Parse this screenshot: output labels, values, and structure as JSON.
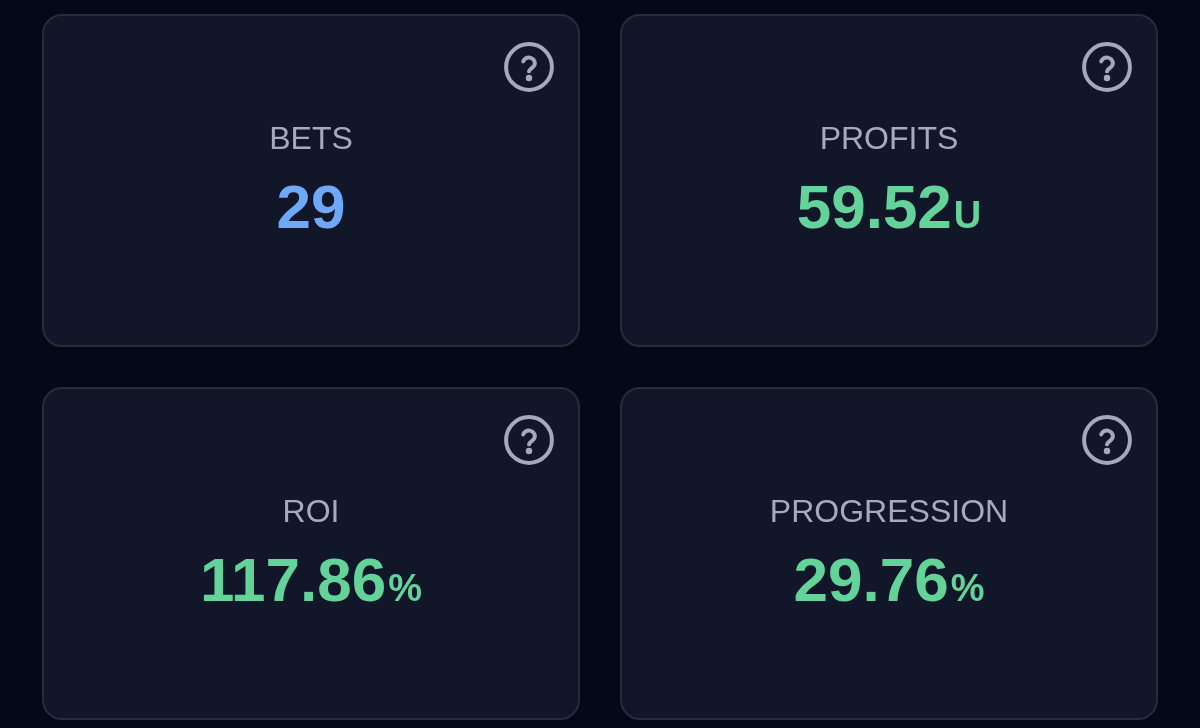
{
  "cards": [
    {
      "label": "BETS",
      "value": "29",
      "color": "#6ea8f8"
    },
    {
      "label": "PROFITS",
      "value": "59.52",
      "unit": "U",
      "color": "#63d39a"
    },
    {
      "label": "ROI",
      "value": "117.86",
      "unit": "%",
      "color": "#63d39a"
    },
    {
      "label": "PROGRESSION",
      "value": "29.76",
      "unit": "%",
      "color": "#63d39a"
    }
  ]
}
